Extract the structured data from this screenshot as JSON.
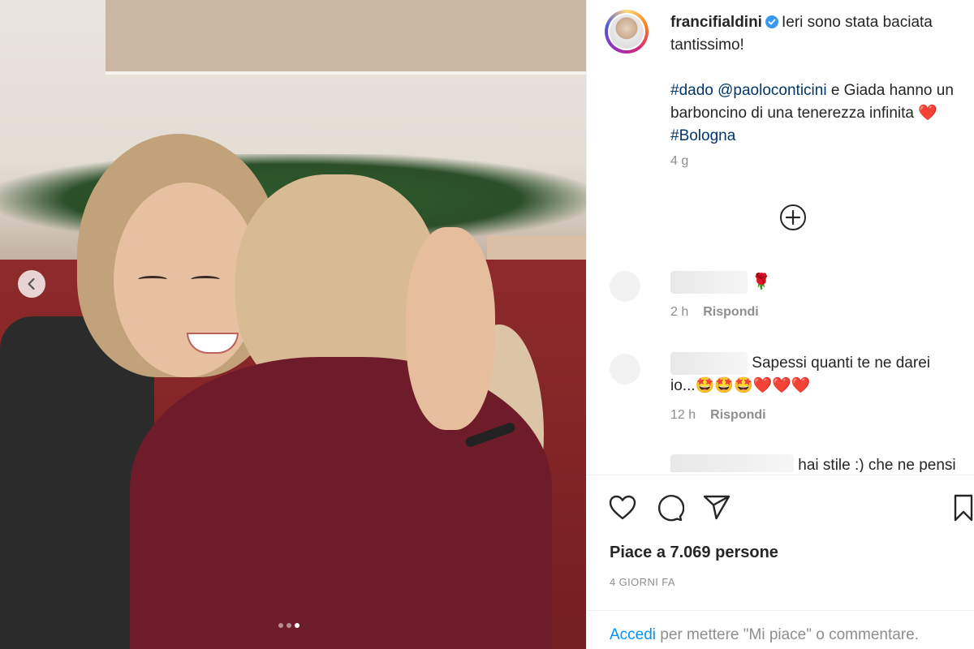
{
  "post": {
    "carousel_dots": 3,
    "active_dot": 2
  },
  "caption": {
    "username": "francifialdini",
    "text_line1": "Ieri sono stata baciata tantissimo!",
    "hashtag_dado": "#dado",
    "mention": "@paoloconticini",
    "text_line2": " e Giada hanno un barboncino di una tenerezza infinita ",
    "hashtag_bologna": "#Bologna",
    "time": "4 g"
  },
  "comments": [
    {
      "text": "🌹",
      "time": "2 h",
      "reply": "Rispondi"
    },
    {
      "text": "Sapessi quanti te ne darei io...🤩🤩🤩❤️❤️❤️",
      "time": "12 h",
      "reply": "Rispondi"
    },
    {
      "text": "hai stile :) che ne pensi"
    }
  ],
  "likes_text": "Piace a 7.069 persone",
  "date_text": "4 GIORNI FA",
  "login": {
    "link": "Accedi",
    "rest": " per mettere \"Mi piace\" o commentare."
  }
}
